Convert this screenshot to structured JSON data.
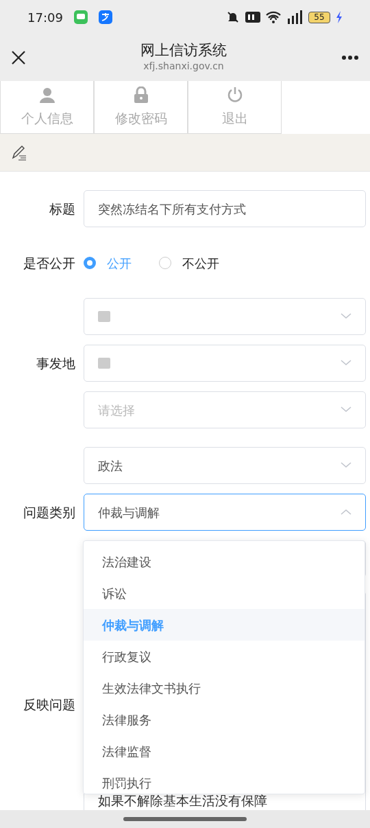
{
  "status_bar": {
    "time": "17:09",
    "battery": "55"
  },
  "header": {
    "title": "网上信访系统",
    "url": "xfj.shanxi.gov.cn"
  },
  "nav_tabs": [
    {
      "label": "个人信息",
      "kind": "person"
    },
    {
      "label": "修改密码",
      "kind": "lock"
    },
    {
      "label": "退出",
      "kind": "power"
    }
  ],
  "form": {
    "title_label": "标题",
    "title_value": "突然冻结名下所有支付方式",
    "public_label": "是否公开",
    "public_options": [
      {
        "label": "公开",
        "selected": true
      },
      {
        "label": "不公开",
        "selected": false
      }
    ],
    "location_label": "事发地",
    "location_selects": [
      {
        "kind": "redacted"
      },
      {
        "kind": "redacted"
      },
      {
        "kind": "empty",
        "placeholder": "请选择"
      }
    ],
    "category_label": "问题类别",
    "category_selects": [
      {
        "value": "政法",
        "expanded": false
      },
      {
        "value": "仲裁与调解",
        "expanded": true
      }
    ],
    "issue_label": "反映问题",
    "issue_text": "如果不解除基本生活没有保障"
  },
  "dropdown": {
    "options": [
      {
        "label": "法治建设",
        "selected": false
      },
      {
        "label": "诉讼",
        "selected": false
      },
      {
        "label": "仲裁与调解",
        "selected": true
      },
      {
        "label": "行政复议",
        "selected": false
      },
      {
        "label": "生效法律文书执行",
        "selected": false
      },
      {
        "label": "法律服务",
        "selected": false
      },
      {
        "label": "法律监督",
        "selected": false
      },
      {
        "label": "刑罚执行",
        "selected": false
      }
    ]
  }
}
